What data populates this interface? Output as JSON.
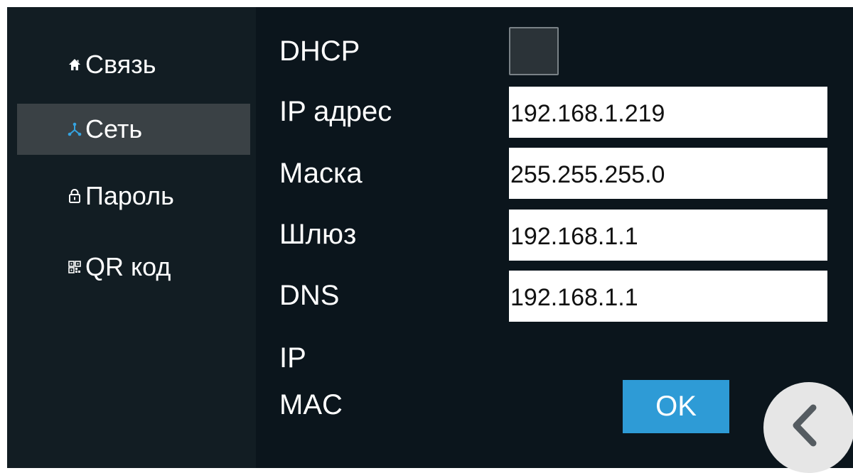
{
  "sidebar": {
    "items": [
      {
        "label": "Связь",
        "icon": "home-icon",
        "active": false
      },
      {
        "label": "Сеть",
        "icon": "network-icon",
        "active": true
      },
      {
        "label": "Пароль",
        "icon": "lock-icon",
        "active": false
      },
      {
        "label": "QR код",
        "icon": "qr-code-icon",
        "active": false
      }
    ]
  },
  "form": {
    "dhcp_label": "DHCP",
    "dhcp_checked": false,
    "ip_label": "IP адрес",
    "ip_value": "192.168.1.219",
    "mask_label": "Маска",
    "mask_value": "255.255.255.0",
    "gateway_label": "Шлюз",
    "gateway_value": "192.168.1.1",
    "dns_label": "DNS",
    "dns_value": "192.168.1.1",
    "ip_info_label": "IP",
    "mac_label": "MAC"
  },
  "actions": {
    "ok_label": "OK",
    "back_icon": "chevron-left-icon"
  },
  "colors": {
    "background": "#0b151c",
    "sidebar": "#121d23",
    "active_item": "#3a4145",
    "accent": "#2e9bd6"
  }
}
